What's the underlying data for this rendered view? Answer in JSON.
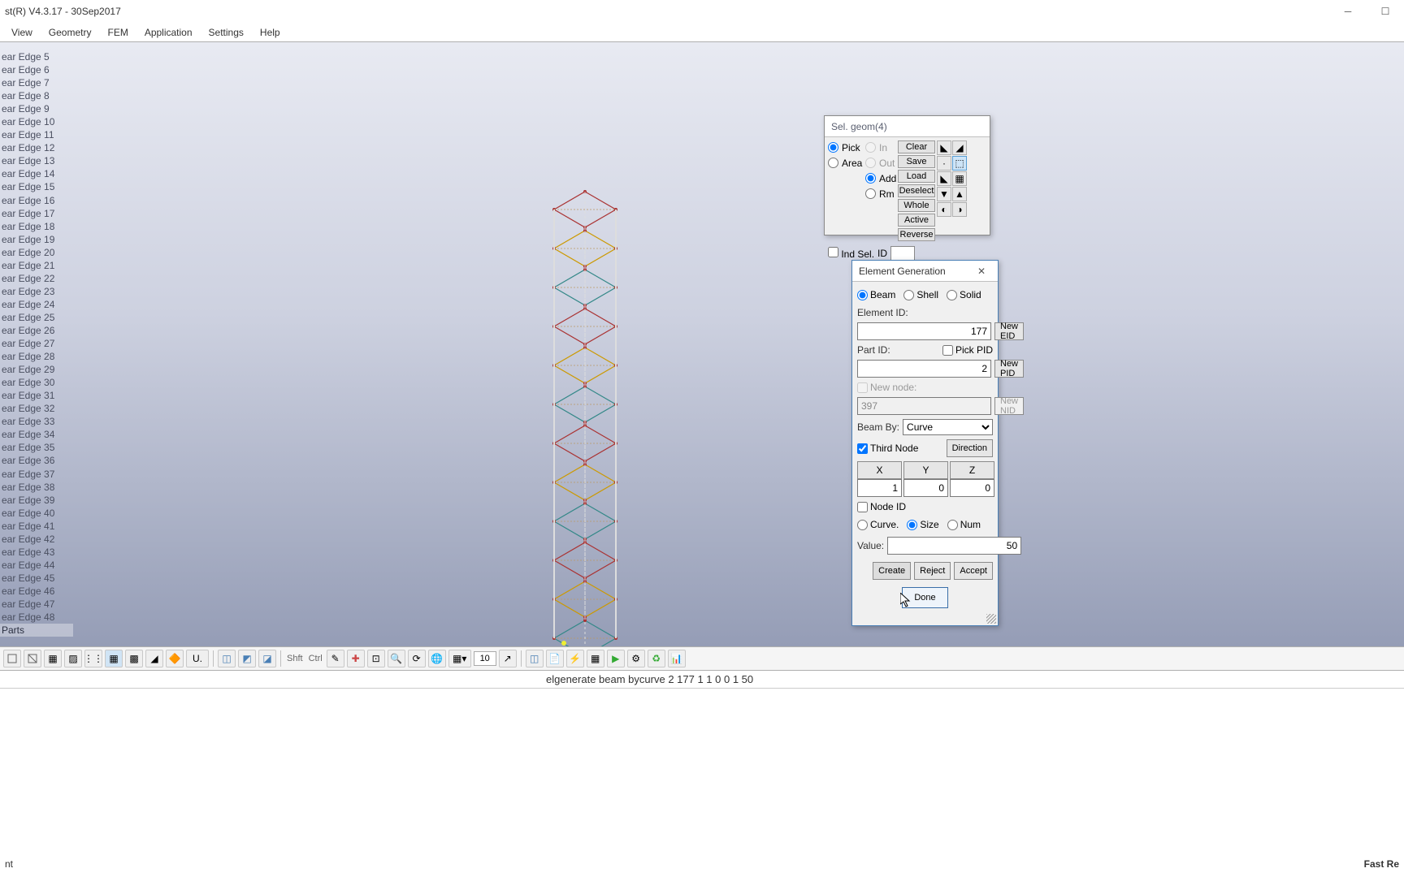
{
  "title": "st(R) V4.3.17 - 30Sep2017",
  "menu": [
    "View",
    "Geometry",
    "FEM",
    "Application",
    "Settings",
    "Help"
  ],
  "tree": {
    "edges_prefix": "ear Edge ",
    "start": 5,
    "end": 48,
    "parts": "Parts"
  },
  "selgeom": {
    "title": "Sel. geom(4)",
    "pick": "Pick",
    "area": "Area",
    "in": "In",
    "out": "Out",
    "add": "Add",
    "rm": "Rm",
    "clear": "Clear",
    "save": "Save",
    "load": "Load",
    "deselect": "Deselect",
    "whole": "Whole",
    "active": "Active",
    "reverse": "Reverse",
    "indsel": "Ind Sel.",
    "id": "ID"
  },
  "elgen": {
    "title": "Element Generation",
    "beam": "Beam",
    "shell": "Shell",
    "solid": "Solid",
    "elementid_lbl": "Element ID:",
    "elementid": "177",
    "neweid": "New EID",
    "partid_lbl": "Part ID:",
    "pickpid": "Pick PID",
    "partid": "2",
    "newpid": "New PID",
    "newnode_lbl": "New node:",
    "newnode": "397",
    "newnid": "New NID",
    "beamby_lbl": "Beam By:",
    "beamby": "Curve",
    "thirdnode": "Third Node",
    "direction": "Direction",
    "x": "X",
    "y": "Y",
    "z": "Z",
    "xv": "1",
    "yv": "0",
    "zv": "0",
    "nodeid": "Node ID",
    "curve": "Curve.",
    "size": "Size",
    "num": "Num",
    "value_lbl": "Value:",
    "value": "50",
    "create": "Create",
    "reject": "Reject",
    "accept": "Accept",
    "done": "Done"
  },
  "toolbar": {
    "shft": "Shft",
    "ctrl": "Ctrl",
    "num": "10"
  },
  "cmd": "elgenerate beam bycurve 2 177 1 1 0 0 1 50",
  "status": {
    "left": "nt",
    "right": "Fast Re"
  }
}
